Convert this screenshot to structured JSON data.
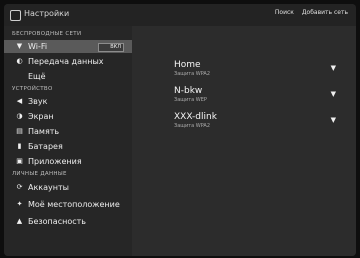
{
  "header": {
    "title": "Настройки",
    "actions": [
      "Поиск",
      "Добавить сеть"
    ]
  },
  "sidebar": {
    "sections": [
      {
        "header": "БЕСПРОВОДНЫЕ СЕТИ",
        "items": [
          {
            "icon": "wifi-icon",
            "label": "Wi-Fi",
            "toggle": "ВКЛ"
          },
          {
            "icon": "data-transfer-icon",
            "label": "Передача данных"
          },
          {
            "icon": "",
            "label": "Ещё"
          }
        ]
      },
      {
        "header": "УСТРОЙСТВО",
        "items": [
          {
            "icon": "sound-icon",
            "label": "Звук"
          },
          {
            "icon": "display-icon",
            "label": "Экран"
          },
          {
            "icon": "storage-icon",
            "label": "Память"
          },
          {
            "icon": "battery-icon",
            "label": "Батарея"
          },
          {
            "icon": "apps-icon",
            "label": "Приложения"
          }
        ]
      },
      {
        "header": "ЛИЧНЫЕ ДАННЫЕ",
        "items": [
          {
            "icon": "accounts-icon",
            "label": "Аккаунты"
          },
          {
            "icon": "location-icon",
            "label": "Моё местоположение"
          },
          {
            "icon": "lock-icon",
            "label": "Безопасность"
          }
        ]
      }
    ]
  },
  "networks": [
    {
      "name": "Home",
      "status": "Защита WPA2"
    },
    {
      "name": "N-bkw",
      "status": "Защита WEP"
    },
    {
      "name": "XXX-dlink",
      "status": "Защита WPA2"
    }
  ]
}
